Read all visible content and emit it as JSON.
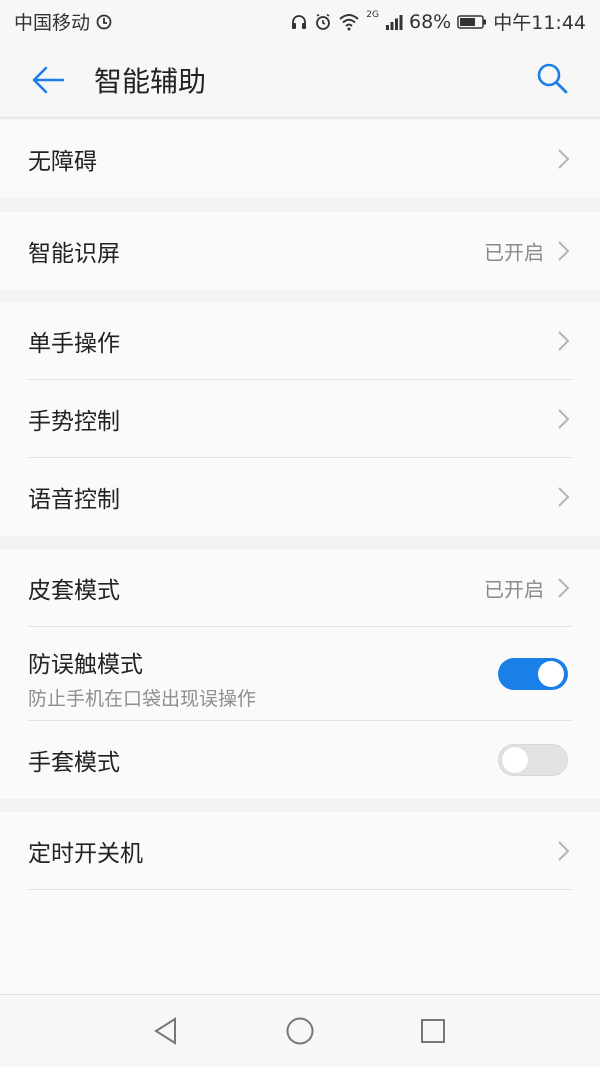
{
  "status_bar": {
    "carrier": "中国移动",
    "network_badge": "2G",
    "battery": "68%",
    "time": "中午11:44",
    "icons": [
      "carrier-signal-icon",
      "headset-icon",
      "alarm-icon",
      "wifi-icon",
      "cell-signal-icon",
      "battery-icon"
    ]
  },
  "app_bar": {
    "title": "智能辅助",
    "accent_color": "#1a7fe6"
  },
  "settings": {
    "accessibility": {
      "label": "无障碍"
    },
    "smart_screen": {
      "label": "智能识屏",
      "value": "已开启"
    },
    "one_hand": {
      "label": "单手操作"
    },
    "gesture": {
      "label": "手势控制"
    },
    "voice": {
      "label": "语音控制"
    },
    "cover_mode": {
      "label": "皮套模式",
      "value": "已开启"
    },
    "pocket_mode": {
      "label": "防误触模式",
      "subtitle": "防止手机在口袋出现误操作",
      "enabled": true
    },
    "glove_mode": {
      "label": "手套模式",
      "enabled": false
    },
    "scheduled_power": {
      "label": "定时开关机"
    }
  },
  "nav": {
    "icons": [
      "back-triangle-icon",
      "home-circle-icon",
      "recents-square-icon"
    ]
  }
}
